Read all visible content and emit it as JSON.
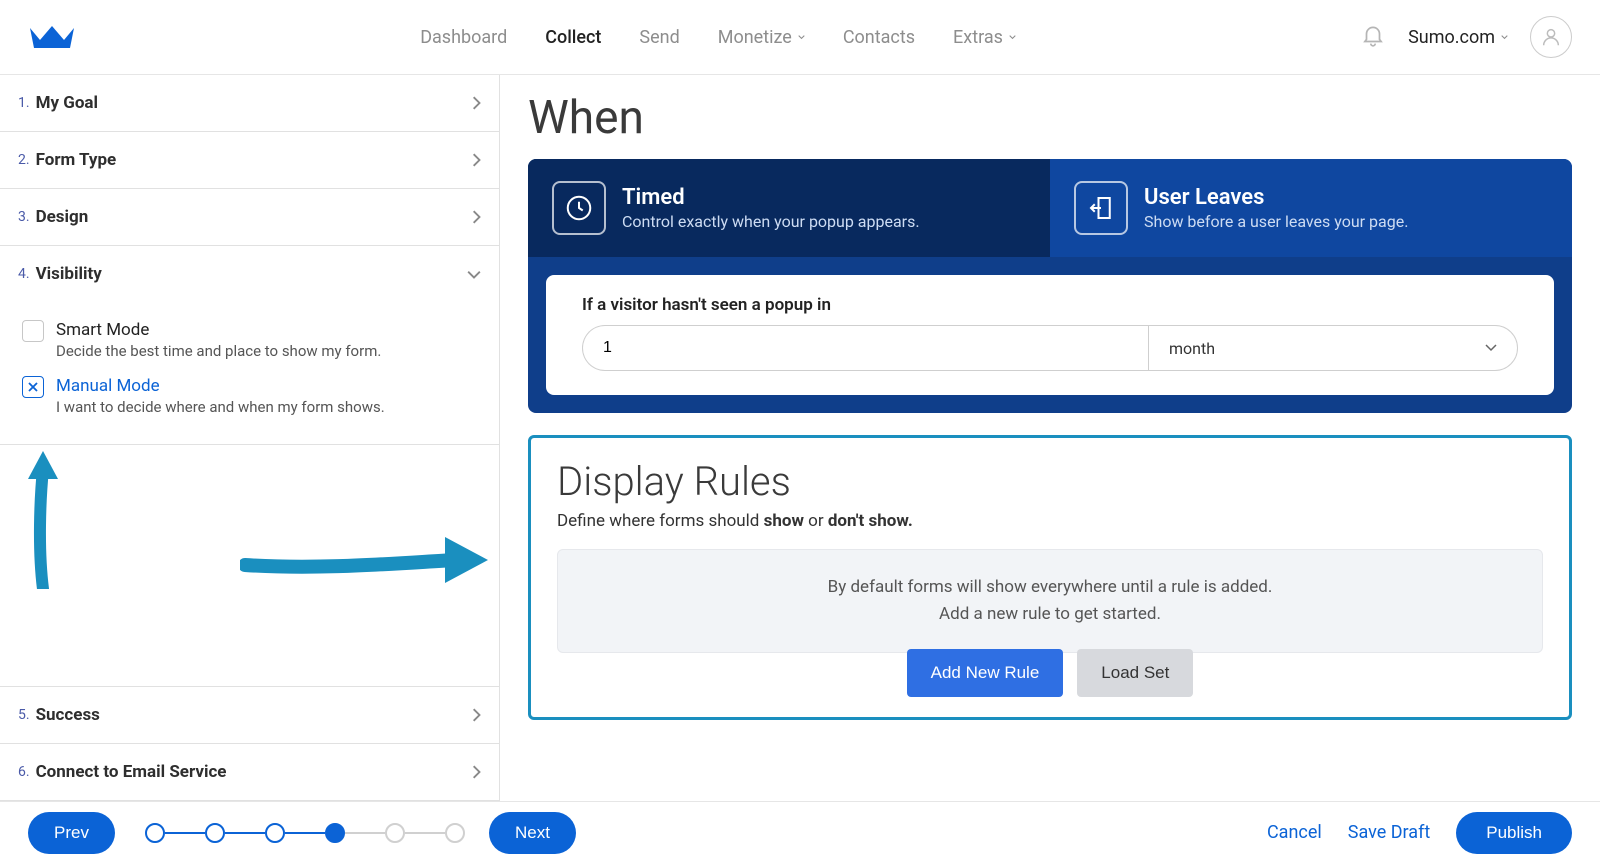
{
  "nav": {
    "dashboard": "Dashboard",
    "collect": "Collect",
    "send": "Send",
    "monetize": "Monetize",
    "contacts": "Contacts",
    "extras": "Extras"
  },
  "workspace": {
    "name": "Sumo.com"
  },
  "steps": {
    "s1": {
      "num": "1.",
      "label": "My Goal"
    },
    "s2": {
      "num": "2.",
      "label": "Form Type"
    },
    "s3": {
      "num": "3.",
      "label": "Design"
    },
    "s4": {
      "num": "4.",
      "label": "Visibility"
    },
    "s5": {
      "num": "5.",
      "label": "Success"
    },
    "s6": {
      "num": "6.",
      "label": "Connect to Email Service"
    }
  },
  "modes": {
    "smart": {
      "title": "Smart Mode",
      "sub": "Decide the best time and place to show my form."
    },
    "manual": {
      "title": "Manual Mode",
      "sub": "I want to decide where and when my form shows."
    }
  },
  "when": {
    "heading": "When",
    "tab_timed": {
      "title": "Timed",
      "sub": "Control exactly when your popup appears."
    },
    "tab_leaves": {
      "title": "User Leaves",
      "sub": "Show before a user leaves your page."
    },
    "form_label": "If a visitor hasn't seen a popup in",
    "value": "1",
    "unit": "month"
  },
  "rules": {
    "title": "Display Rules",
    "sub_a": "Define where forms should ",
    "sub_b": "show",
    "sub_c": " or ",
    "sub_d": "don't show.",
    "empty_line1": "By default forms will show everywhere until a rule is added.",
    "empty_line2": "Add a new rule to get started.",
    "add": "Add New Rule",
    "load": "Load Set"
  },
  "footer": {
    "prev": "Prev",
    "next": "Next",
    "cancel": "Cancel",
    "savedraft": "Save Draft",
    "publish": "Publish"
  }
}
